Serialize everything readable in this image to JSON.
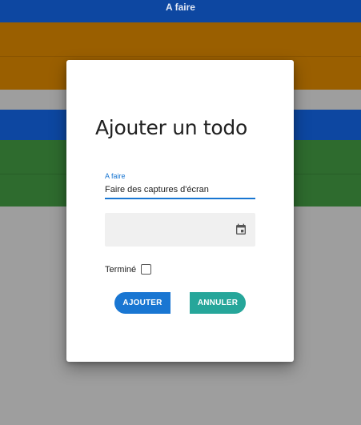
{
  "list": {
    "header_title": "A faire"
  },
  "dialog": {
    "title": "Ajouter un todo",
    "todo_field": {
      "label": "A faire",
      "value": "Faire des captures d'écran"
    },
    "date_field": {
      "value": "",
      "icon": "calendar-icon"
    },
    "done": {
      "label": "Terminé",
      "checked": false
    },
    "buttons": {
      "add_label": "AJOUTER",
      "cancel_label": "ANNULER"
    }
  },
  "colors": {
    "primary": "#1976d2",
    "cancel": "#26a69a",
    "header_blue": "#0d47a1",
    "orange": "#9a5f00",
    "green": "#2e6b2e",
    "backdrop": "#9e9e9e"
  }
}
